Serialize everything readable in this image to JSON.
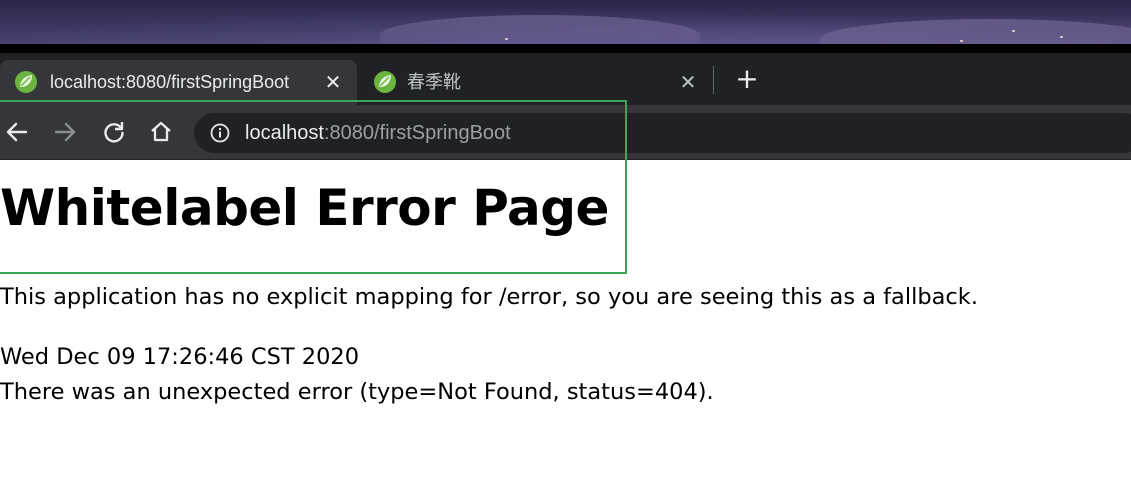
{
  "browser": {
    "tabs": [
      {
        "title": "localhost:8080/firstSpringBoot",
        "favicon": "spring-leaf-icon",
        "active": true,
        "close": "✕"
      },
      {
        "title": "春季靴",
        "favicon": "spring-leaf-icon",
        "active": false,
        "close": "✕"
      }
    ],
    "new_tab": "+",
    "address_bar": {
      "host": "localhost",
      "path": ":8080/firstSpringBoot"
    },
    "icons": {
      "back": "back-arrow-icon",
      "forward": "forward-arrow-icon",
      "reload": "reload-icon",
      "home": "home-icon",
      "site_info": "info-icon"
    }
  },
  "page": {
    "heading": "Whitelabel Error Page",
    "message": "This application has no explicit mapping for /error, so you are seeing this as a fallback.",
    "timestamp": "Wed Dec 09 17:26:46 CST 2020",
    "error": "There was an unexpected error (type=Not Found, status=404)."
  },
  "colors": {
    "tabstrip": "#202124",
    "toolbar": "#35363a",
    "highlight": "#3aa757",
    "spring_green": "#6db33f"
  }
}
